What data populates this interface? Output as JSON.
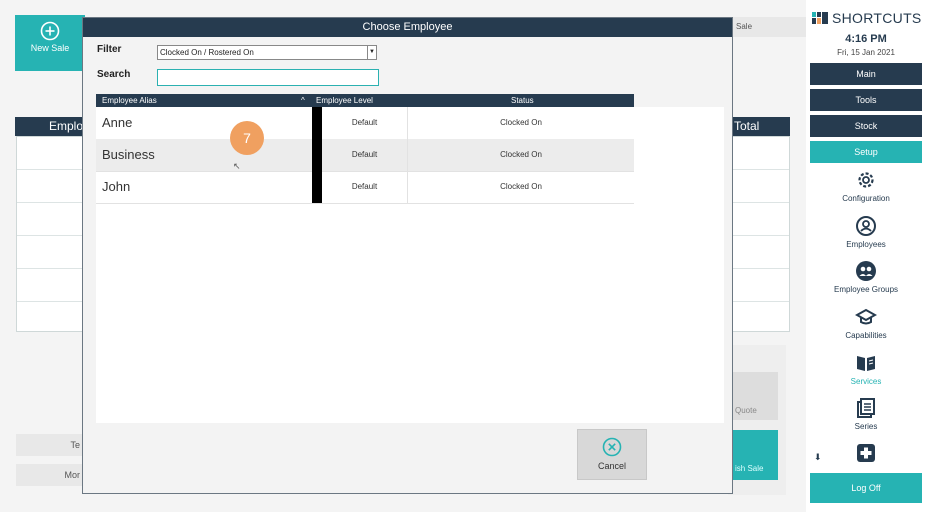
{
  "background": {
    "new_sale": "New Sale",
    "employee_header": "Emplo",
    "total_header": "Total",
    "sale_tab": "Sale",
    "btn_t": "Te",
    "btn_m": "Mor",
    "quote": "Quote",
    "finish_sale": "ish Sale"
  },
  "modal": {
    "title": "Choose Employee",
    "filter_label": "Filter",
    "filter_value": "Clocked On / Rostered On",
    "search_label": "Search",
    "search_value": "",
    "columns": {
      "alias": "Employee Alias",
      "sort_indicator": "^",
      "level": "Employee Level",
      "status": "Status"
    },
    "rows": [
      {
        "alias": "Anne",
        "level": "Default",
        "status": "Clocked On"
      },
      {
        "alias": "Business",
        "level": "Default",
        "status": "Clocked On"
      },
      {
        "alias": "John",
        "level": "Default",
        "status": "Clocked On"
      }
    ],
    "badge": "7",
    "cancel_label": "Cancel"
  },
  "sidebar": {
    "logo": "SHORTCUTS",
    "time": "4:16 PM",
    "date": "Fri, 15 Jan 2021",
    "nav": {
      "main": "Main",
      "tools": "Tools",
      "stock": "Stock",
      "setup": "Setup"
    },
    "items": {
      "configuration": "Configuration",
      "employees": "Employees",
      "employee_groups": "Employee Groups",
      "capabilities": "Capabilities",
      "services": "Services",
      "series": "Series"
    },
    "logoff": "Log Off"
  },
  "colors": {
    "navy": "#263b4f",
    "teal": "#26b3b3",
    "badge": "#f0a060"
  }
}
